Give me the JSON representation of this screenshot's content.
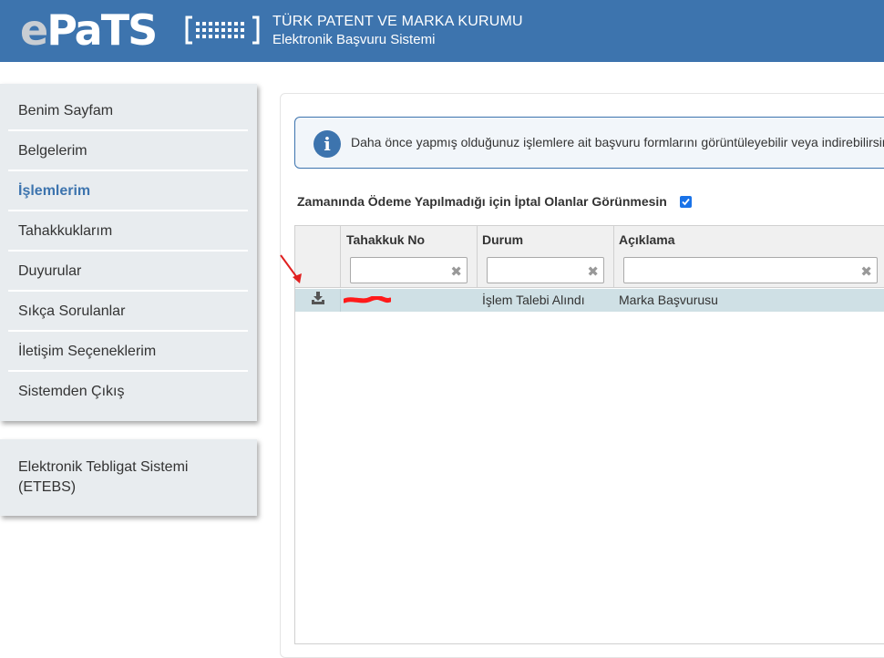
{
  "header": {
    "logo_text_e": "e",
    "logo_text_rest": "PaTS",
    "org_name": "TÜRK PATENT VE MARKA KURUMU",
    "system_name": "Elektronik Başvuru Sistemi",
    "background_color": "#3d74ae"
  },
  "sidebar": {
    "items": [
      {
        "label": "Benim Sayfam",
        "active": false
      },
      {
        "label": "Belgelerim",
        "active": false
      },
      {
        "label": "İşlemlerim",
        "active": true
      },
      {
        "label": "Tahakkuklarım",
        "active": false
      },
      {
        "label": "Duyurular",
        "active": false
      },
      {
        "label": "Sıkça Sorulanlar",
        "active": false
      },
      {
        "label": "İletişim Seçeneklerim",
        "active": false
      },
      {
        "label": "Sistemden Çıkış",
        "active": false
      }
    ],
    "etebs_line1": "Elektronik Tebligat Sistemi",
    "etebs_line2": "(ETEBS)"
  },
  "info": {
    "icon": "info-icon",
    "text": "Daha önce yapmış olduğunuz işlemlere ait başvuru formlarını görüntüleyebilir veya indirebilirsiniz."
  },
  "filter_checkbox": {
    "label": "Zamanında Ödeme Yapılmadığı için İptal Olanlar Görünmesin",
    "checked": true
  },
  "table": {
    "columns": [
      "",
      "Tahakkuk No",
      "Durum",
      "Açıklama"
    ],
    "filters": [
      "",
      "",
      ""
    ],
    "rows": [
      {
        "icon": "download-icon",
        "tahakkuk_no": "[redacted]",
        "durum": "İşlem Talebi Alındı",
        "aciklama": "Marka Başvurusu"
      }
    ]
  },
  "colors": {
    "accent": "#3d74ae",
    "row_highlight": "#cfe0e5",
    "annotation_arrow": "#e02020"
  }
}
